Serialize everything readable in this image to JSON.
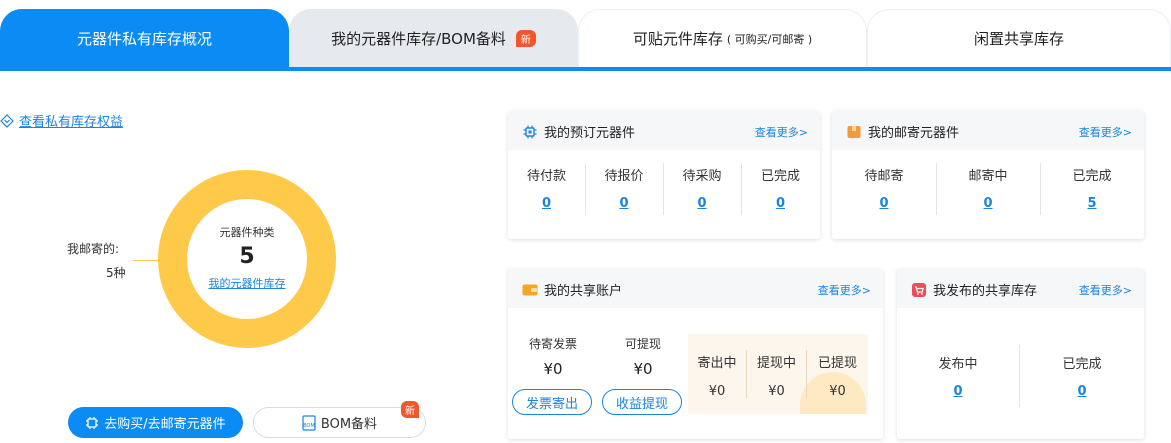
{
  "tabs": [
    {
      "label": "元器件私有库存概况"
    },
    {
      "label": "我的元器件库存/BOM备料",
      "badge": "新"
    },
    {
      "label": "可贴元件库存",
      "sub": "( 可购买/可邮寄 )"
    },
    {
      "label": "闲置共享库存"
    }
  ],
  "left": {
    "benefit_link": "查看私有库存权益",
    "donut_kind_label": "元器件种类",
    "donut_count": "5",
    "donut_link": "我的元器件库存",
    "legend_label": "我邮寄的:",
    "legend_value": "5种",
    "buy_button": "去购买/去邮寄元器件",
    "bom_button": "BOM备料",
    "bom_badge": "新"
  },
  "colors": {
    "accent": "#0b8cf5",
    "donut": "#ffc94a",
    "badge": "#f2562d",
    "link": "#1a84e0"
  },
  "cards": {
    "reserved": {
      "title": "我的预订元器件",
      "more": "查看更多>",
      "icon": "chip-icon",
      "items": [
        {
          "label": "待付款",
          "value": "0"
        },
        {
          "label": "待报价",
          "value": "0"
        },
        {
          "label": "待采购",
          "value": "0"
        },
        {
          "label": "已完成",
          "value": "0"
        }
      ]
    },
    "mailed": {
      "title": "我的邮寄元器件",
      "more": "查看更多>",
      "icon": "package-icon",
      "items": [
        {
          "label": "待邮寄",
          "value": "0"
        },
        {
          "label": "邮寄中",
          "value": "0"
        },
        {
          "label": "已完成",
          "value": "5"
        }
      ]
    },
    "account": {
      "title": "我的共享账户",
      "more": "查看更多>",
      "icon": "wallet-icon",
      "pending_invoice_label": "待寄发票",
      "pending_invoice_value": "¥0",
      "withdrawable_label": "可提现",
      "withdrawable_value": "¥0",
      "invoice_button": "发票寄出",
      "withdraw_button": "收益提现",
      "flow": [
        {
          "label": "寄出中",
          "value": "¥0"
        },
        {
          "label": "提现中",
          "value": "¥0"
        },
        {
          "label": "已提现",
          "value": "¥0"
        }
      ]
    },
    "published": {
      "title": "我发布的共享库存",
      "more": "查看更多>",
      "icon": "cart-icon",
      "items": [
        {
          "label": "发布中",
          "value": "0"
        },
        {
          "label": "已完成",
          "value": "0"
        }
      ]
    }
  }
}
